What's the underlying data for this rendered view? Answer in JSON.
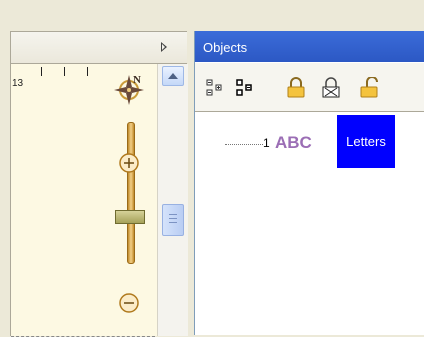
{
  "map": {
    "ruler_label": "13",
    "compass_letter": "N"
  },
  "objects_panel": {
    "title": "Objects",
    "toolbar": [
      {
        "name": "expand-all-icon"
      },
      {
        "name": "collapse-all-icon"
      },
      {
        "name": "lock-icon"
      },
      {
        "name": "remove-lock-icon"
      },
      {
        "name": "unlock-icon"
      }
    ],
    "tree": [
      {
        "number": "1",
        "badge": "ABC",
        "label": "Letters"
      }
    ]
  },
  "colors": {
    "title_bar": "#2c58c4",
    "selection": "#0000ff",
    "badge": "#9b6eb5"
  }
}
